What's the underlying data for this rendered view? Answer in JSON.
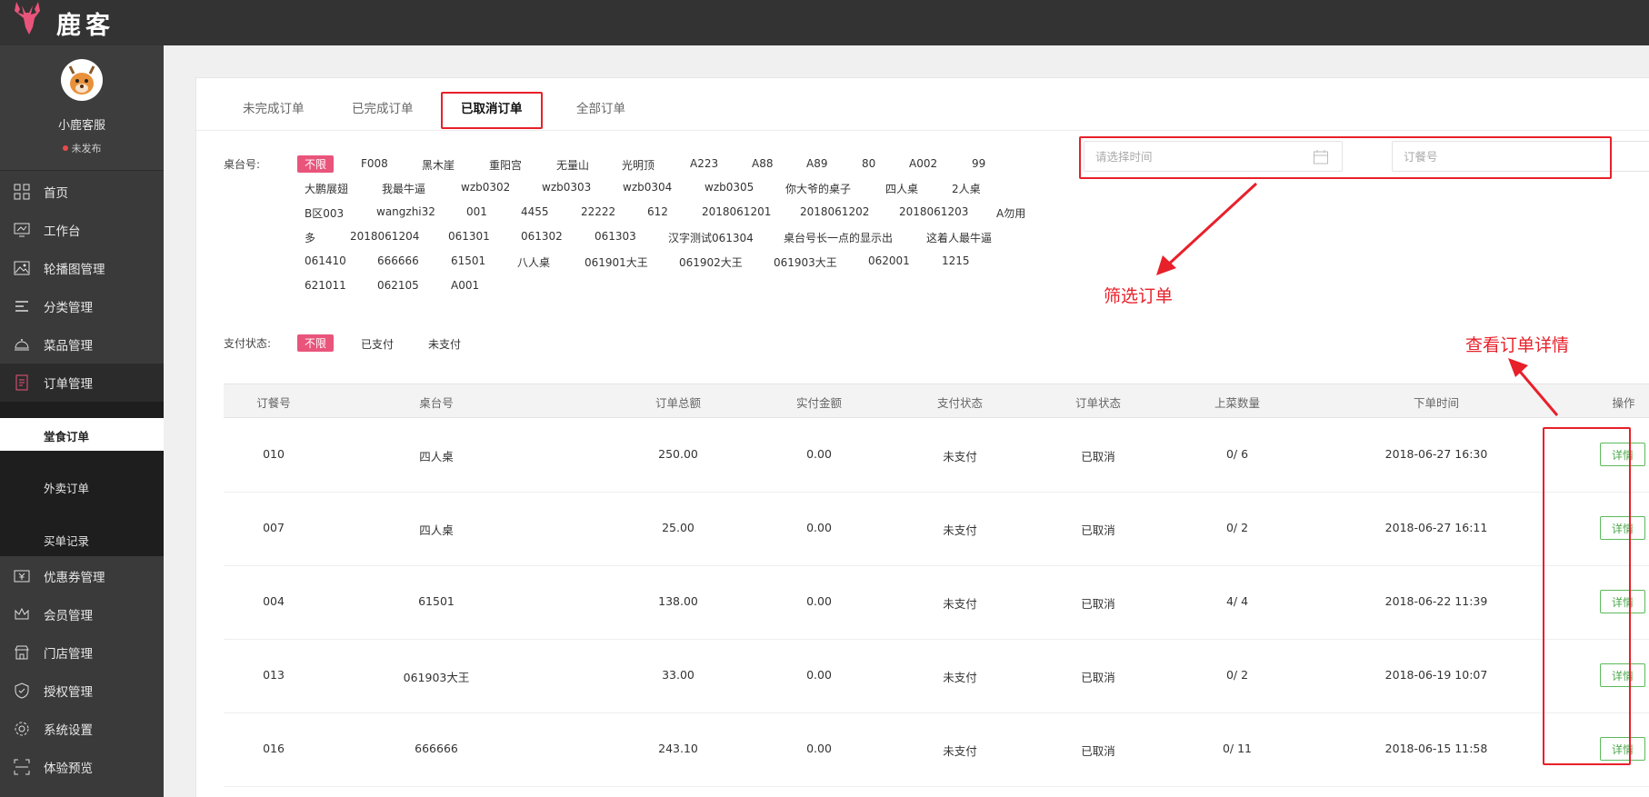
{
  "app": {
    "logo_text": "鹿客"
  },
  "profile": {
    "name": "小鹿客服",
    "status": "未发布"
  },
  "menu": {
    "home": "首页",
    "workbench": "工作台",
    "carousel": "轮播图管理",
    "category": "分类管理",
    "dishes": "菜品管理",
    "orders": "订单管理",
    "sub_dinein": "堂食订单",
    "sub_takeout": "外卖订单",
    "sub_bill": "买单记录",
    "coupons": "优惠券管理",
    "members": "会员管理",
    "stores": "门店管理",
    "auth": "授权管理",
    "settings": "系统设置",
    "preview": "体验预览"
  },
  "tabs": [
    "未完成订单",
    "已完成订单",
    "已取消订单",
    "全部订单"
  ],
  "filters": {
    "table_label": "桌台号:",
    "table_all": "不限",
    "tables_row1": [
      "F008",
      "黑木崖",
      "重阳宫",
      "无量山",
      "光明顶",
      "A223",
      "A88",
      "A89",
      "80",
      "A002",
      "99"
    ],
    "tables_row2": [
      "大鹏展翅",
      "我最牛逼",
      "wzb0302",
      "wzb0303",
      "wzb0304",
      "wzb0305",
      "你大爷的桌子",
      "四人桌",
      "2人桌"
    ],
    "tables_row3": [
      "B区003",
      "wangzhi32",
      "001",
      "4455",
      "22222",
      "612",
      "2018061201",
      "2018061202",
      "2018061203",
      "A勿用"
    ],
    "tables_row4": [
      "多",
      "2018061204",
      "061301",
      "061302",
      "061303",
      "汉字测试061304",
      "桌台号长一点的显示出",
      "这着人最牛逼"
    ],
    "tables_row5": [
      "061410",
      "666666",
      "61501",
      "八人桌",
      "061901大王",
      "061902大王",
      "061903大王",
      "062001",
      "1215"
    ],
    "tables_row6": [
      "621011",
      "062105",
      "A001"
    ],
    "pay_label": "支付状态:",
    "pay_all": "不限",
    "pay_paid": "已支付",
    "pay_unpaid": "未支付",
    "time_placeholder": "请选择时间",
    "order_placeholder": "订餐号"
  },
  "table": {
    "headers": [
      "订餐号",
      "桌台号",
      "订单总额",
      "实付金额",
      "支付状态",
      "订单状态",
      "上菜数量",
      "下单时间",
      "操作"
    ],
    "action_label": "详情",
    "rows": [
      [
        "010",
        "四人桌",
        "250.00",
        "0.00",
        "未支付",
        "已取消",
        "0/ 6",
        "2018-06-27 16:30"
      ],
      [
        "007",
        "四人桌",
        "25.00",
        "0.00",
        "未支付",
        "已取消",
        "0/ 2",
        "2018-06-27 16:11"
      ],
      [
        "004",
        "61501",
        "138.00",
        "0.00",
        "未支付",
        "已取消",
        "4/ 4",
        "2018-06-22 11:39"
      ],
      [
        "013",
        "061903大王",
        "33.00",
        "0.00",
        "未支付",
        "已取消",
        "0/ 2",
        "2018-06-19 10:07"
      ],
      [
        "016",
        "666666",
        "243.10",
        "0.00",
        "未支付",
        "已取消",
        "0/ 11",
        "2018-06-15 11:58"
      ]
    ]
  },
  "annotations": {
    "filter_note": "筛选订单",
    "detail_note": "查看订单详情"
  },
  "colors": {
    "accent": "#e9547b",
    "annotation": "#e8202a",
    "detail": "#4aa84a",
    "topbar": "#333333"
  }
}
